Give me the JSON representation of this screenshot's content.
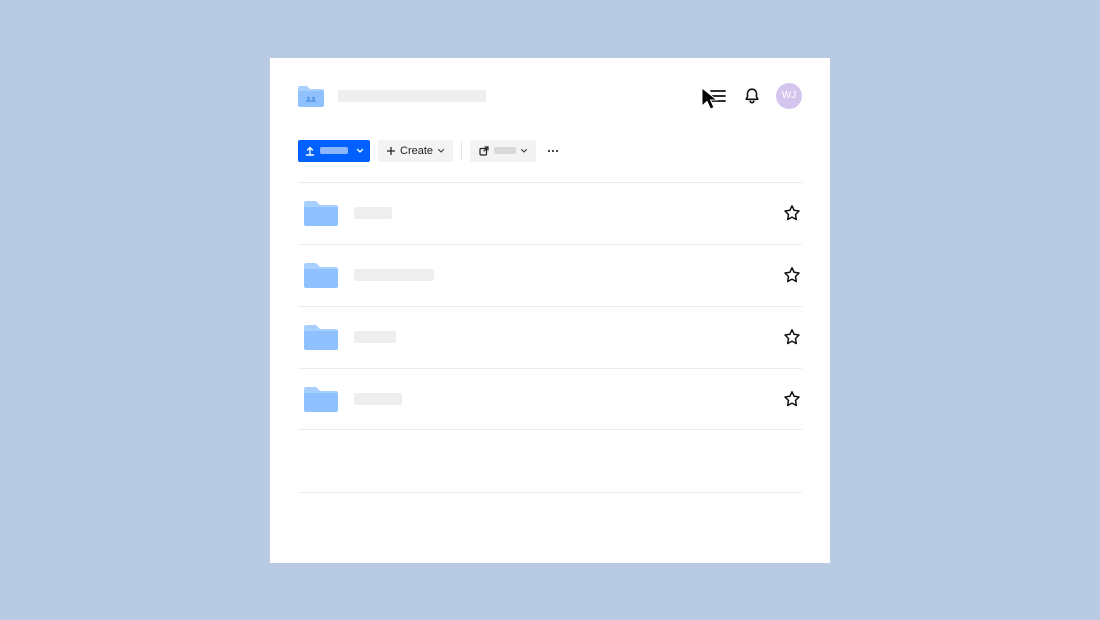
{
  "header": {
    "avatar_initials": "WJ",
    "avatar_color": "#d5c5ee"
  },
  "toolbar": {
    "upload_label": "",
    "create_label": "Create",
    "export_label": ""
  },
  "files": [
    {
      "name_width": 38,
      "starred": false
    },
    {
      "name_width": 80,
      "starred": false
    },
    {
      "name_width": 42,
      "starred": false
    },
    {
      "name_width": 48,
      "starred": false
    }
  ],
  "colors": {
    "folder_light": "#a8d0ff",
    "folder_dark": "#8fc1ff",
    "accent": "#0061fe"
  }
}
